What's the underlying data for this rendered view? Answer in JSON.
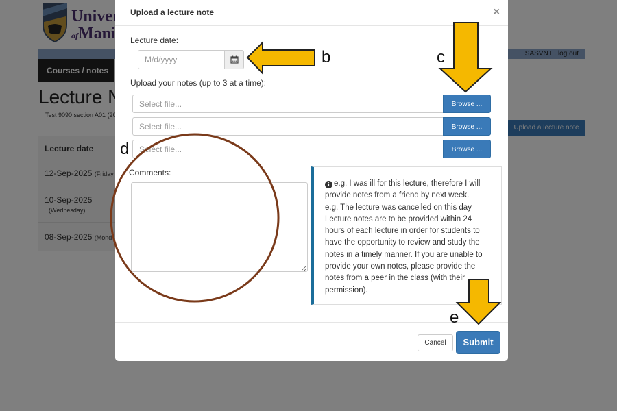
{
  "background": {
    "logo": {
      "line1": "Univer",
      "line2_prefix": "of",
      "line2": "Manit"
    },
    "header": {
      "user_links": "SASVNT . log out"
    },
    "nav": {
      "active_tab": "Courses / notes"
    },
    "page_title": "Lecture N",
    "course_info": "Test 9090 section A01 (20",
    "upload_button_label": "Upload a lecture note",
    "lecture_table": {
      "header": "Lecture date",
      "rows": [
        {
          "date": "12-Sep-2025",
          "day": "(Friday"
        },
        {
          "date": "10-Sep-2025",
          "day": "(Wednesday)"
        },
        {
          "date": "08-Sep-2025",
          "day": "(Mond"
        }
      ]
    }
  },
  "modal": {
    "title": "Upload a lecture note",
    "close_symbol": "×",
    "lecture_date_label": "Lecture date:",
    "lecture_date_placeholder": "M/d/yyyy",
    "upload_label": "Upload your notes (up to 3 at a time):",
    "file_inputs": [
      {
        "placeholder": "Select file...",
        "button": "Browse ..."
      },
      {
        "placeholder": "Select file...",
        "button": "Browse ..."
      },
      {
        "placeholder": "Select file...",
        "button": "Browse ..."
      }
    ],
    "comments_label": "Comments:",
    "info_lines": [
      "e.g. I was ill for this lecture, therefore I will",
      "provide notes from a friend by next week.",
      "e.g. The lecture was cancelled on this day",
      "Lecture notes are to be provided within 24",
      "hours of each lecture in order for students to",
      "have the opportunity to review and study the",
      "notes in a timely manner. If you are unable to",
      "provide your own notes, please provide the",
      "notes from a peer in the class (with their",
      "permission)."
    ],
    "cancel_label": "Cancel",
    "submit_label": "Submit"
  },
  "annotations": {
    "letters": {
      "b": "b",
      "c": "c",
      "d": "d",
      "e": "e"
    },
    "arrow_color": "#F5B800",
    "circle_color": "#7A3A1A"
  },
  "icons": {
    "calendar": "calendar-icon",
    "info": "info-icon",
    "close": "close-icon",
    "logo": "university-crest-icon"
  }
}
